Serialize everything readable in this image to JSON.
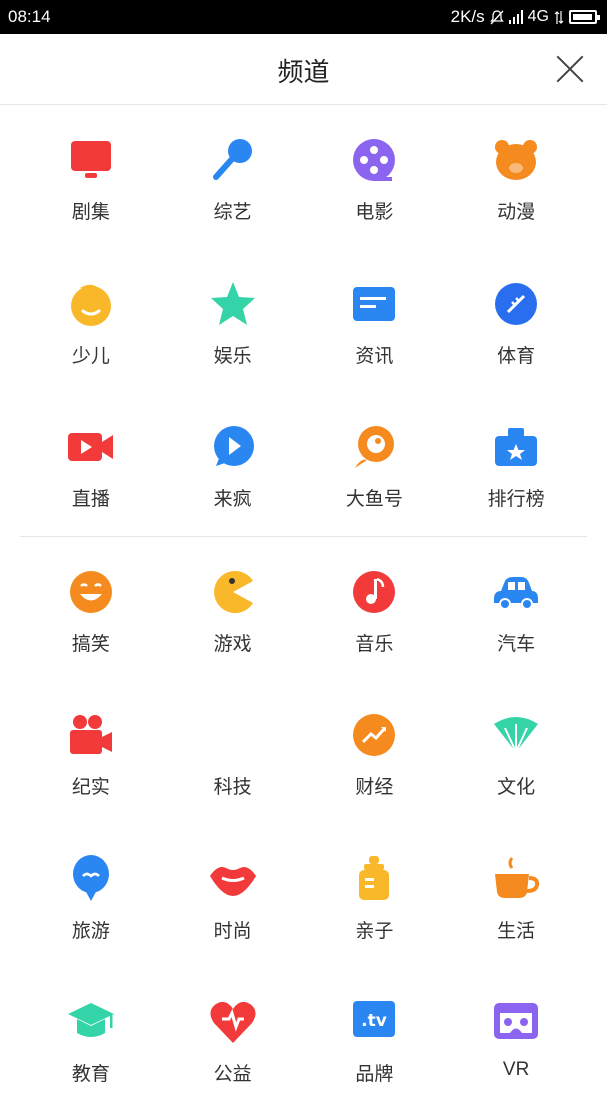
{
  "status": {
    "time": "08:14",
    "speed": "2K/s",
    "network": "4G"
  },
  "header": {
    "title": "频道"
  },
  "channels": [
    [
      {
        "label": "剧集",
        "icon": "tv-icon",
        "color": "#f23a3a"
      },
      {
        "label": "综艺",
        "icon": "microphone-icon",
        "color": "#2a86f0"
      },
      {
        "label": "电影",
        "icon": "film-reel-icon",
        "color": "#8b64f0"
      },
      {
        "label": "动漫",
        "icon": "bear-icon",
        "color": "#f58a1e"
      }
    ],
    [
      {
        "label": "少儿",
        "icon": "child-face-icon",
        "color": "#f9b82a"
      },
      {
        "label": "娱乐",
        "icon": "star-icon",
        "color": "#35d3a8"
      },
      {
        "label": "资讯",
        "icon": "news-icon",
        "color": "#2a86f0"
      },
      {
        "label": "体育",
        "icon": "football-icon",
        "color": "#2a6ef0"
      }
    ],
    [
      {
        "label": "直播",
        "icon": "video-camera-icon",
        "color": "#f23a3a"
      },
      {
        "label": "来疯",
        "icon": "play-bubble-icon",
        "color": "#2a86f0"
      },
      {
        "label": "大鱼号",
        "icon": "fish-icon",
        "color": "#f58a1e"
      },
      {
        "label": "排行榜",
        "icon": "ranking-icon",
        "color": "#2a86f0"
      }
    ]
  ],
  "channels_more": [
    [
      {
        "label": "搞笑",
        "icon": "laugh-face-icon",
        "color": "#f58a1e"
      },
      {
        "label": "游戏",
        "icon": "pacman-icon",
        "color": "#f9b82a"
      },
      {
        "label": "音乐",
        "icon": "music-note-icon",
        "color": "#f23a3a"
      },
      {
        "label": "汽车",
        "icon": "car-icon",
        "color": "#2a86f0"
      }
    ],
    [
      {
        "label": "纪实",
        "icon": "movie-camera-icon",
        "color": "#f23a3a"
      },
      {
        "label": "科技",
        "icon": "tech-icon",
        "color": "#ffffff"
      },
      {
        "label": "财经",
        "icon": "trend-up-icon",
        "color": "#f58a1e"
      },
      {
        "label": "文化",
        "icon": "fan-icon",
        "color": "#35d3a8"
      }
    ],
    [
      {
        "label": "旅游",
        "icon": "balloon-icon",
        "color": "#2a86f0"
      },
      {
        "label": "时尚",
        "icon": "lips-icon",
        "color": "#f23a3a"
      },
      {
        "label": "亲子",
        "icon": "baby-bottle-icon",
        "color": "#f9b82a"
      },
      {
        "label": "生活",
        "icon": "coffee-cup-icon",
        "color": "#f58a1e"
      }
    ],
    [
      {
        "label": "教育",
        "icon": "graduation-cap-icon",
        "color": "#35d3a8"
      },
      {
        "label": "公益",
        "icon": "heart-icon",
        "color": "#f23a3a"
      },
      {
        "label": "品牌",
        "icon": "tv-badge-icon",
        "color": "#2a86f0"
      },
      {
        "label": "VR",
        "icon": "vr-glasses-icon",
        "color": "#8b64f0"
      }
    ]
  ],
  "glyphs": {
    "news": "☰",
    "tv_badge": ".tv",
    "music": "♪",
    "star": "★"
  }
}
